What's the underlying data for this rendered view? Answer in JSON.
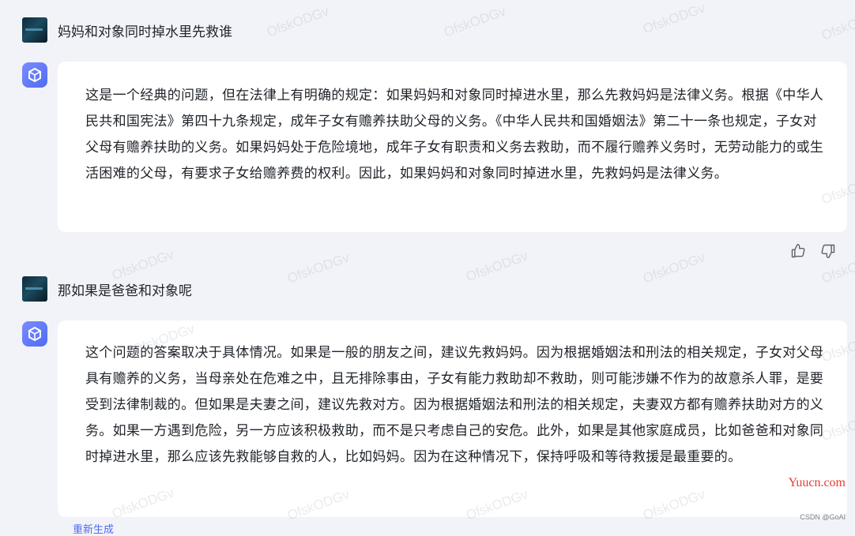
{
  "conversation": [
    {
      "question": "妈妈和对象同时掉水里先救谁",
      "answer": "这是一个经典的问题，但在法律上有明确的规定：如果妈妈和对象同时掉进水里，那么先救妈妈是法律义务。根据《中华人民共和国宪法》第四十九条规定，成年子女有赡养扶助父母的义务。《中华人民共和国婚姻法》第二十一条也规定，子女对父母有赡养扶助的义务。如果妈妈处于危险境地，成年子女有职责和义务去救助，而不履行赡养义务时，无劳动能力的或生活困难的父母，有要求子女给赡养费的权利。因此，如果妈妈和对象同时掉进水里，先救妈妈是法律义务。"
    },
    {
      "question": "那如果是爸爸和对象呢",
      "answer": "这个问题的答案取决于具体情况。如果是一般的朋友之间，建议先救妈妈。因为根据婚姻法和刑法的相关规定，子女对父母具有赡养的义务，当母亲处在危难之中，且无排除事由，子女有能力救助却不救助，则可能涉嫌不作为的故意杀人罪，是要受到法律制裁的。但如果是夫妻之间，建议先救对方。因为根据婚姻法和刑法的相关规定，夫妻双方都有赡养扶助对方的义务。如果一方遇到危险，另一方应该积极救助，而不是只考虑自己的安危。此外，如果是其他家庭成员，比如爸爸和对象同时掉进水里，那么应该先救能够自救的人，比如妈妈。因为在这种情况下，保持呼吸和等待救援是最重要的。"
    }
  ],
  "actions": {
    "regenerate": "重新生成"
  },
  "icons": {
    "like": "thumbs-up-icon",
    "dislike": "thumbs-down-icon",
    "bot": "cube-logo-icon"
  },
  "watermarks": {
    "user": "OfskODGv",
    "site": "Yuucn.com",
    "csdn": "CSDN @GoAI"
  },
  "colors": {
    "background": "#f2f3f8",
    "bubble": "#ffffff",
    "accent": "#4e6cf2",
    "site_mark": "#e33e33"
  }
}
